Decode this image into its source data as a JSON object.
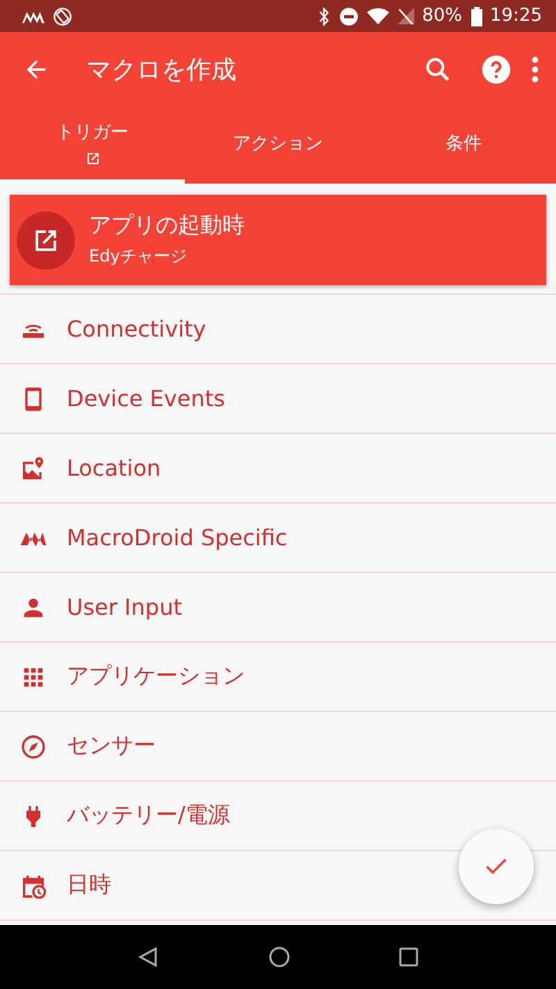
{
  "status_bar": {
    "battery": "80%",
    "time": "19:25"
  },
  "toolbar": {
    "title": "マクロを作成"
  },
  "tabs": [
    {
      "label": "トリガー",
      "selected": true,
      "has_icon": true
    },
    {
      "label": "アクション",
      "selected": false,
      "has_icon": false
    },
    {
      "label": "条件",
      "selected": false,
      "has_icon": false
    }
  ],
  "selected_trigger": {
    "title": "アプリの起動時",
    "subtitle": "Edyチャージ"
  },
  "categories": [
    {
      "label": "Connectivity"
    },
    {
      "label": "Device Events"
    },
    {
      "label": "Location"
    },
    {
      "label": "MacroDroid Specific"
    },
    {
      "label": "User Input"
    },
    {
      "label": "アプリケーション"
    },
    {
      "label": "センサー"
    },
    {
      "label": "バッテリー/電源"
    },
    {
      "label": "日時"
    }
  ]
}
